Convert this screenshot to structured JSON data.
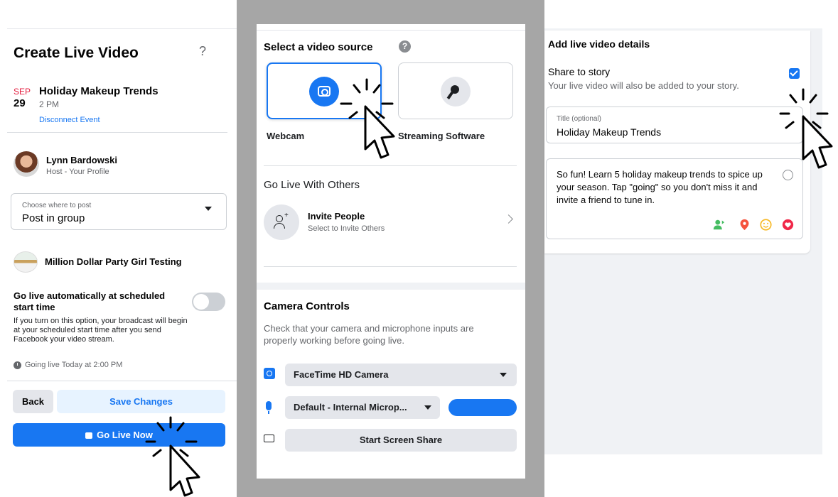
{
  "left_panel": {
    "title": "Create Live Video",
    "help_label": "?",
    "event": {
      "month": "SEP",
      "day": "29",
      "name": "Holiday Makeup Trends",
      "time": "2 PM",
      "disconnect_label": "Disconnect Event"
    },
    "host": {
      "name": "Lynn Bardowski",
      "role": "Host - Your Profile"
    },
    "post_location": {
      "label": "Choose where to post",
      "value": "Post in group"
    },
    "group_name": "Million Dollar Party Girl Testing",
    "auto_live": {
      "title": "Go live automatically at scheduled start time",
      "description": "If you turn on this option, your broadcast will begin at your scheduled start time after you send Facebook your video stream.",
      "enabled": false
    },
    "schedule_text": "Going live Today at 2:00 PM",
    "buttons": {
      "back": "Back",
      "save": "Save Changes",
      "go_live": "Go Live Now"
    }
  },
  "middle_panel": {
    "source_title": "Select a video source",
    "sources": [
      {
        "label": "Webcam",
        "icon": "camera-icon",
        "selected": true
      },
      {
        "label": "Streaming Software",
        "icon": "key-icon",
        "selected": false
      }
    ],
    "others_title": "Go Live With Others",
    "invite": {
      "name": "Invite People",
      "sub": "Select to Invite Others"
    },
    "camera_controls": {
      "title": "Camera Controls",
      "description": "Check that your camera and microphone inputs are properly working before going live.",
      "camera_select": "FaceTime HD Camera",
      "mic_select": "Default - Internal Microp...",
      "screen_share": "Start Screen Share"
    }
  },
  "right_panel": {
    "title": "Add live video details",
    "share_story": {
      "title": "Share to story",
      "sub": "Your live video will also be added to your story.",
      "checked": true
    },
    "title_field": {
      "label": "Title (optional)",
      "value": "Holiday Makeup Trends"
    },
    "description": "So fun! Learn 5 holiday makeup trends to spice up your season. Tap \"going\" so you don't miss it and invite a friend to tune in.",
    "attach_icons": [
      "tag-people-icon",
      "location-pin-icon",
      "feeling-icon",
      "heart-badge-icon"
    ]
  },
  "colors": {
    "accent": "#1877f2",
    "date_red": "#e41e3f",
    "surround_gray": "#a6a6a6"
  }
}
